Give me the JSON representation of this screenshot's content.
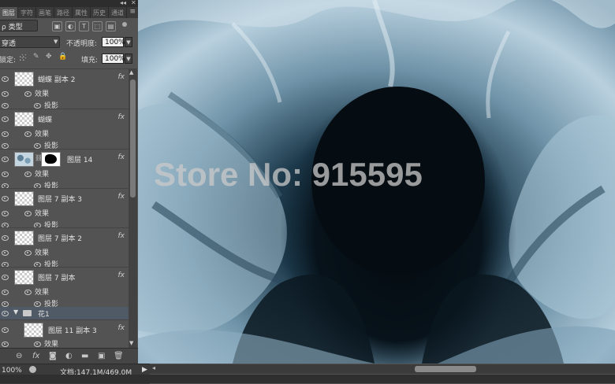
{
  "panel": {
    "tabs": [
      "图层",
      "字符",
      "画笔",
      "路径",
      "属性",
      "历史",
      "通道"
    ],
    "menu_glyph": "≡",
    "collapse_glyph": "◂◂",
    "close_glyph": "✕",
    "filter_select": "ρ 类型",
    "filter_icons": [
      "▣",
      "◐",
      "T",
      "⬚",
      "▤"
    ],
    "blend_mode": "穿透",
    "opacity_label": "不透明度:",
    "opacity_value": "100%",
    "lock_label": "锁定:",
    "fill_label": "填充:",
    "fill_value": "100%",
    "layers": [
      {
        "name": "蝴蝶 副本 2",
        "fx": "fx",
        "effects": "效果",
        "shadow": "投影"
      },
      {
        "name": "蝴蝶",
        "fx": "fx",
        "effects": "效果",
        "shadow": "投影"
      },
      {
        "name": "图层 14",
        "fx": "fx",
        "effects": "效果",
        "shadow": "投影"
      },
      {
        "name": "图层 7 副本 3",
        "fx": "fx",
        "effects": "效果",
        "shadow": "投影"
      },
      {
        "name": "图层 7 副本 2",
        "fx": "fx",
        "effects": "效果",
        "shadow": "投影"
      },
      {
        "name": "图层 7 副本",
        "fx": "fx",
        "effects": "效果",
        "shadow": "投影"
      }
    ],
    "group": {
      "name": "花1"
    },
    "group_child": {
      "name": "图层 11 副本 3",
      "fx": "fx",
      "effects": "效果"
    },
    "bottom_icons": [
      "⊖",
      "fx",
      "◙",
      "◐",
      "▬",
      "▣",
      "🗑"
    ]
  },
  "status": {
    "zoom": "100%",
    "doc": "文档:147.1M/469.0M",
    "play": "▶"
  },
  "canvas": {
    "watermark": "Store No: 915595"
  }
}
